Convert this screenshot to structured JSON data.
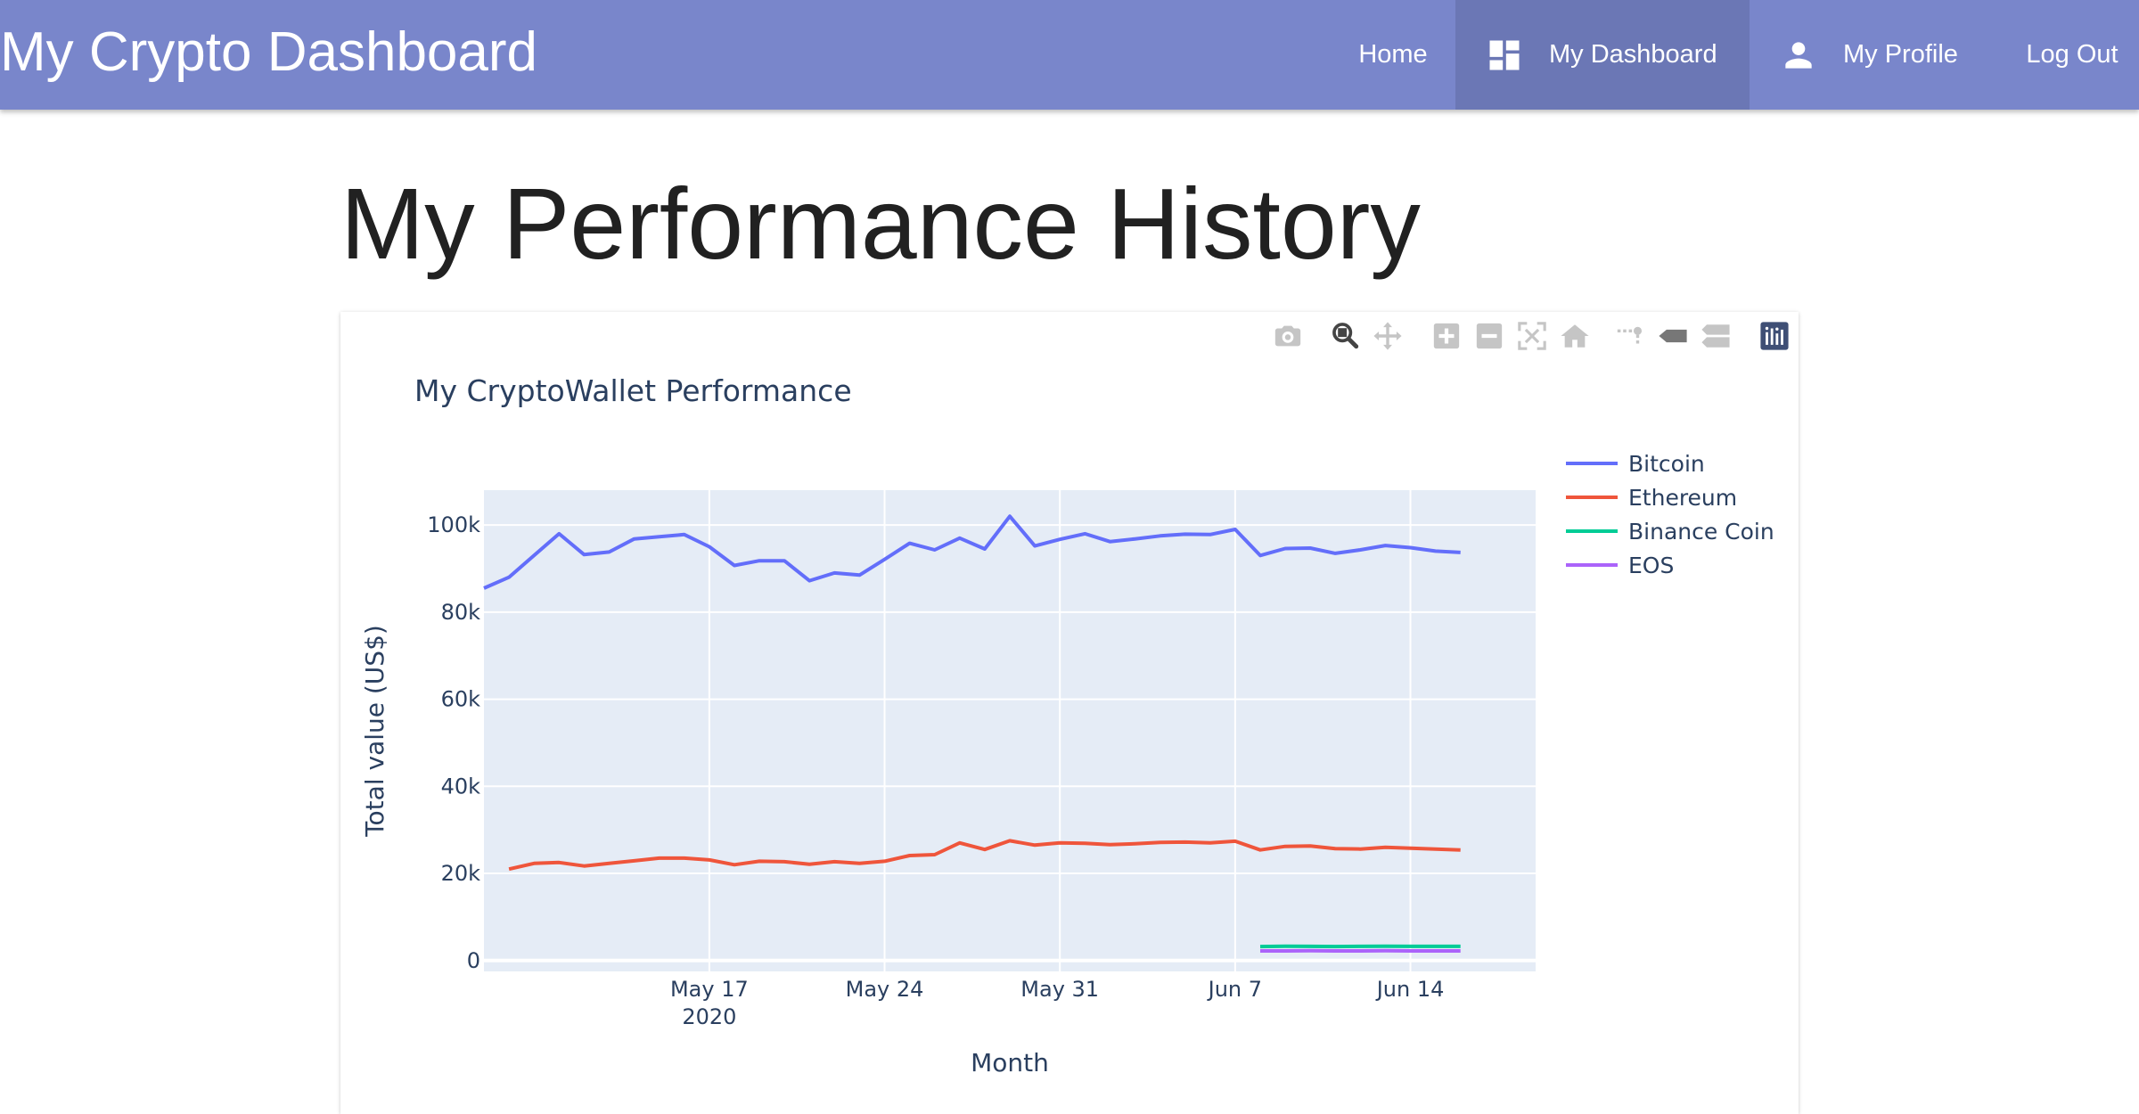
{
  "app": {
    "title": "My Crypto Dashboard"
  },
  "nav": {
    "home": "Home",
    "dashboard": "My Dashboard",
    "profile": "My Profile",
    "logout": "Log Out"
  },
  "page": {
    "title": "My Performance History"
  },
  "modebar": {
    "buttons": [
      "camera-icon",
      "zoom-icon",
      "pan-icon",
      "zoom-in-icon",
      "zoom-out-icon",
      "autoscale-icon",
      "reset-axes-icon",
      "spike-lines-icon",
      "hover-closest-icon",
      "hover-compare-icon",
      "plotly-logo-icon"
    ],
    "active": "zoom-icon"
  },
  "chart_data": {
    "type": "line",
    "title": "My CryptoWallet Performance",
    "xlabel": "Month",
    "ylabel": "Total value (US$)",
    "xlim": [
      "2020-05-08",
      "2020-06-19"
    ],
    "ylim": [
      -2500,
      108000
    ],
    "x_ticks": [
      {
        "date": "2020-05-17",
        "label": "May 17",
        "sublabel": "2020"
      },
      {
        "date": "2020-05-24",
        "label": "May 24",
        "sublabel": ""
      },
      {
        "date": "2020-05-31",
        "label": "May 31",
        "sublabel": ""
      },
      {
        "date": "2020-06-07",
        "label": "Jun 7",
        "sublabel": ""
      },
      {
        "date": "2020-06-14",
        "label": "Jun 14",
        "sublabel": ""
      }
    ],
    "y_ticks": [
      {
        "value": 0,
        "label": "0"
      },
      {
        "value": 20000,
        "label": "20k"
      },
      {
        "value": 40000,
        "label": "40k"
      },
      {
        "value": 60000,
        "label": "60k"
      },
      {
        "value": 80000,
        "label": "80k"
      },
      {
        "value": 100000,
        "label": "100k"
      }
    ],
    "grid": true,
    "plot_background": "#e5ecf6",
    "legend_position": "top-right",
    "series": [
      {
        "name": "Bitcoin",
        "color": "#636efa",
        "points": [
          [
            "2020-05-08",
            85500
          ],
          [
            "2020-05-09",
            88000
          ],
          [
            "2020-05-10",
            93000
          ],
          [
            "2020-05-11",
            98000
          ],
          [
            "2020-05-12",
            93200
          ],
          [
            "2020-05-13",
            93800
          ],
          [
            "2020-05-14",
            96800
          ],
          [
            "2020-05-15",
            97300
          ],
          [
            "2020-05-16",
            97800
          ],
          [
            "2020-05-17",
            95000
          ],
          [
            "2020-05-18",
            90700
          ],
          [
            "2020-05-19",
            91800
          ],
          [
            "2020-05-20",
            91800
          ],
          [
            "2020-05-21",
            87200
          ],
          [
            "2020-05-22",
            89000
          ],
          [
            "2020-05-23",
            88500
          ],
          [
            "2020-05-24",
            92100
          ],
          [
            "2020-05-25",
            95800
          ],
          [
            "2020-05-26",
            94300
          ],
          [
            "2020-05-27",
            97000
          ],
          [
            "2020-05-28",
            94500
          ],
          [
            "2020-05-29",
            102000
          ],
          [
            "2020-05-30",
            95200
          ],
          [
            "2020-05-31",
            96700
          ],
          [
            "2020-06-01",
            98000
          ],
          [
            "2020-06-02",
            96200
          ],
          [
            "2020-06-03",
            96800
          ],
          [
            "2020-06-04",
            97500
          ],
          [
            "2020-06-05",
            97900
          ],
          [
            "2020-06-06",
            97800
          ],
          [
            "2020-06-07",
            99000
          ],
          [
            "2020-06-08",
            93000
          ],
          [
            "2020-06-09",
            94600
          ],
          [
            "2020-06-10",
            94700
          ],
          [
            "2020-06-11",
            93500
          ],
          [
            "2020-06-12",
            94300
          ],
          [
            "2020-06-13",
            95300
          ],
          [
            "2020-06-14",
            94800
          ],
          [
            "2020-06-15",
            94000
          ],
          [
            "2020-06-16",
            93700
          ]
        ]
      },
      {
        "name": "Ethereum",
        "color": "#ef553b",
        "points": [
          [
            "2020-05-09",
            21000
          ],
          [
            "2020-05-10",
            22300
          ],
          [
            "2020-05-11",
            22500
          ],
          [
            "2020-05-12",
            21700
          ],
          [
            "2020-05-13",
            22300
          ],
          [
            "2020-05-14",
            22900
          ],
          [
            "2020-05-15",
            23500
          ],
          [
            "2020-05-16",
            23500
          ],
          [
            "2020-05-17",
            23100
          ],
          [
            "2020-05-18",
            22000
          ],
          [
            "2020-05-19",
            22800
          ],
          [
            "2020-05-20",
            22700
          ],
          [
            "2020-05-21",
            22100
          ],
          [
            "2020-05-22",
            22700
          ],
          [
            "2020-05-23",
            22300
          ],
          [
            "2020-05-24",
            22800
          ],
          [
            "2020-05-25",
            24100
          ],
          [
            "2020-05-26",
            24300
          ],
          [
            "2020-05-27",
            27000
          ],
          [
            "2020-05-28",
            25500
          ],
          [
            "2020-05-29",
            27500
          ],
          [
            "2020-05-30",
            26500
          ],
          [
            "2020-05-31",
            27000
          ],
          [
            "2020-06-01",
            26900
          ],
          [
            "2020-06-02",
            26600
          ],
          [
            "2020-06-03",
            26800
          ],
          [
            "2020-06-04",
            27100
          ],
          [
            "2020-06-05",
            27200
          ],
          [
            "2020-06-06",
            27000
          ],
          [
            "2020-06-07",
            27400
          ],
          [
            "2020-06-08",
            25400
          ],
          [
            "2020-06-09",
            26200
          ],
          [
            "2020-06-10",
            26300
          ],
          [
            "2020-06-11",
            25700
          ],
          [
            "2020-06-12",
            25600
          ],
          [
            "2020-06-13",
            26000
          ],
          [
            "2020-06-14",
            25800
          ],
          [
            "2020-06-15",
            25600
          ],
          [
            "2020-06-16",
            25400
          ]
        ]
      },
      {
        "name": "Binance Coin",
        "color": "#00cc96",
        "points": [
          [
            "2020-06-08",
            3200
          ],
          [
            "2020-06-09",
            3300
          ],
          [
            "2020-06-10",
            3250
          ],
          [
            "2020-06-11",
            3200
          ],
          [
            "2020-06-12",
            3250
          ],
          [
            "2020-06-13",
            3300
          ],
          [
            "2020-06-14",
            3250
          ],
          [
            "2020-06-15",
            3250
          ],
          [
            "2020-06-16",
            3250
          ]
        ]
      },
      {
        "name": "EOS",
        "color": "#ab63fa",
        "points": [
          [
            "2020-06-08",
            2200
          ],
          [
            "2020-06-09",
            2200
          ],
          [
            "2020-06-10",
            2250
          ],
          [
            "2020-06-11",
            2200
          ],
          [
            "2020-06-12",
            2200
          ],
          [
            "2020-06-13",
            2250
          ],
          [
            "2020-06-14",
            2200
          ],
          [
            "2020-06-15",
            2200
          ],
          [
            "2020-06-16",
            2200
          ]
        ]
      }
    ]
  }
}
